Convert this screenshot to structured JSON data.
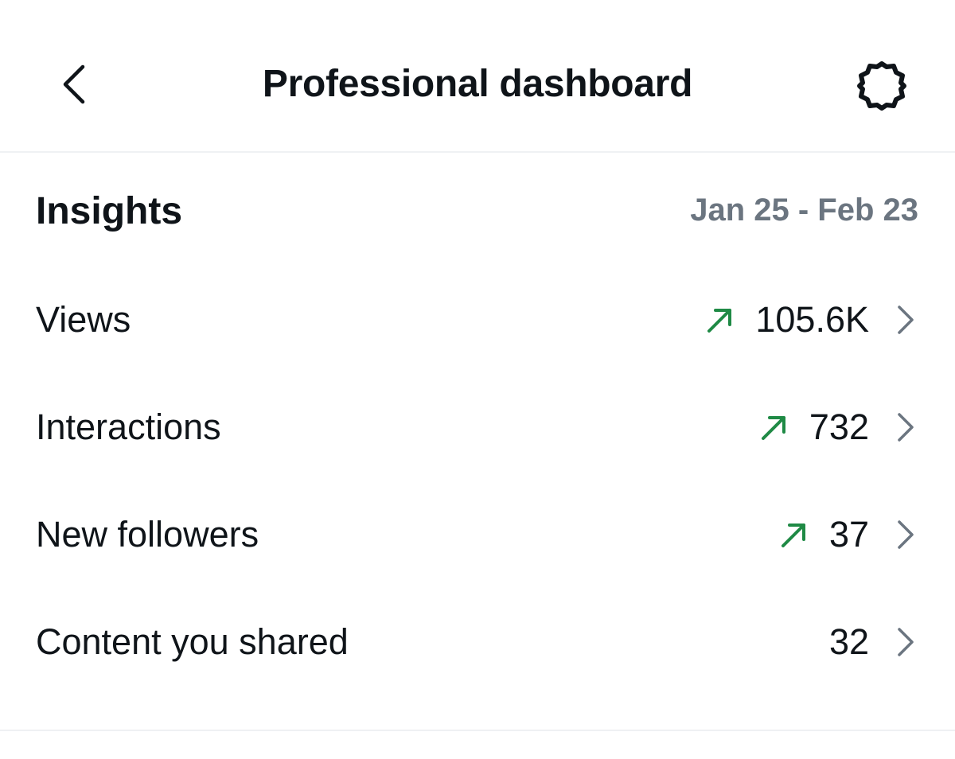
{
  "header": {
    "title": "Professional dashboard",
    "back_icon": "chevron-left-icon",
    "settings_icon": "gear-icon"
  },
  "insights": {
    "title": "Insights",
    "date_range": "Jan 25 - Feb 23"
  },
  "metrics": [
    {
      "label": "Views",
      "value": "105.6K",
      "trend": "up"
    },
    {
      "label": "Interactions",
      "value": "732",
      "trend": "up"
    },
    {
      "label": "New followers",
      "value": "37",
      "trend": "up"
    },
    {
      "label": "Content you shared",
      "value": "32",
      "trend": "none"
    }
  ],
  "colors": {
    "text_primary": "#0f1419",
    "text_secondary": "#6b7580",
    "trend_up": "#1f8a45",
    "chevron": "#6b7580",
    "divider": "#eff1f3"
  }
}
